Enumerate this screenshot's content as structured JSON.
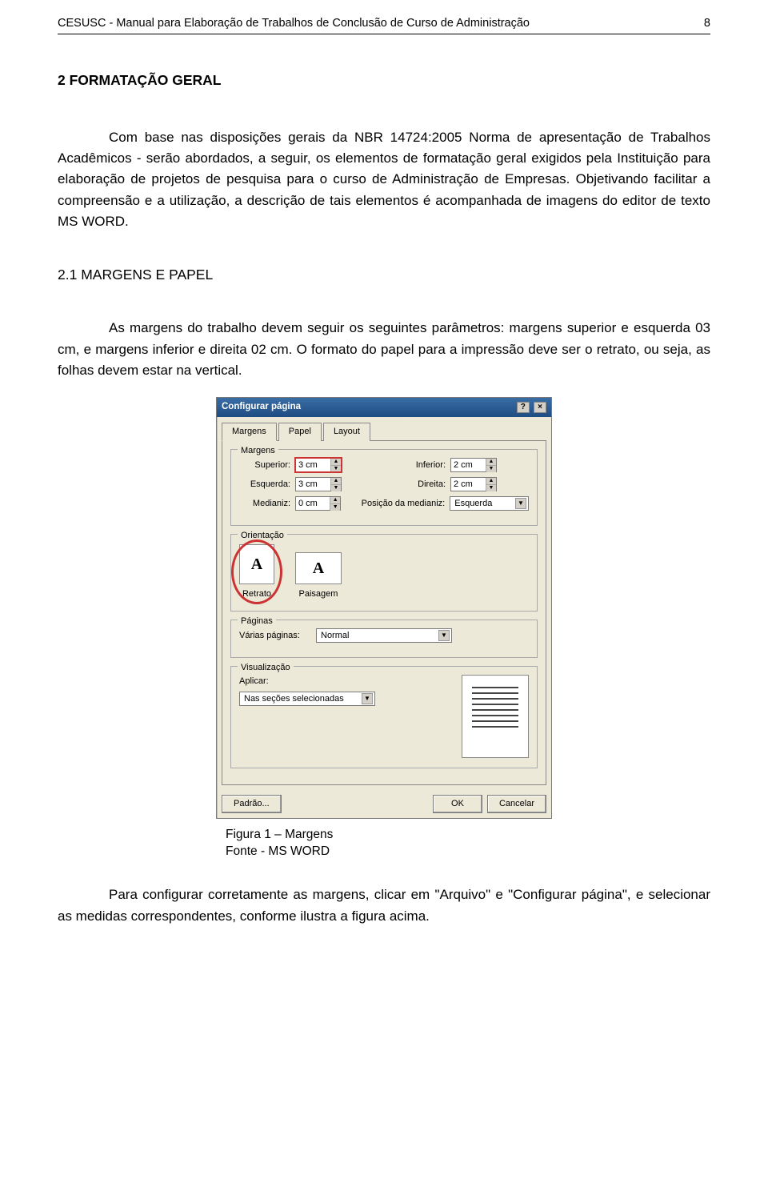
{
  "header": {
    "title": "CESUSC - Manual para Elaboração de Trabalhos de Conclusão de Curso de Administração",
    "page_number": "8"
  },
  "section": {
    "heading": "2 FORMATAÇÃO GERAL",
    "para1": "Com base nas disposições gerais da NBR 14724:2005 Norma de apresentação de Trabalhos Acadêmicos - serão abordados, a seguir, os elementos de formatação geral exigidos pela Instituição para elaboração de projetos de pesquisa para o curso de Administração de Empresas. Objetivando facilitar a compreensão e a utilização, a descrição de tais elementos é acompanhada de imagens do editor de texto MS WORD."
  },
  "subsection": {
    "heading": "2.1 MARGENS E PAPEL",
    "para1": "As margens do trabalho devem seguir os seguintes parâmetros: margens superior e esquerda 03 cm, e margens inferior e direita 02 cm. O formato do papel para a impressão deve ser o retrato, ou seja, as folhas devem estar na vertical."
  },
  "dialog": {
    "title": "Configurar página",
    "tabs": {
      "margens": "Margens",
      "papel": "Papel",
      "layout": "Layout"
    },
    "group_margens": "Margens",
    "labels": {
      "superior": "Superior:",
      "inferior": "Inferior:",
      "esquerda": "Esquerda:",
      "direita": "Direita:",
      "medianiz": "Medianiz:",
      "pos_medianiz": "Posição da medianiz:"
    },
    "values": {
      "superior": "3 cm",
      "inferior": "2 cm",
      "esquerda": "3 cm",
      "direita": "2 cm",
      "medianiz": "0 cm",
      "pos_medianiz": "Esquerda"
    },
    "group_orient": "Orientação",
    "orient": {
      "retrato": "Retrato",
      "paisagem": "Paisagem"
    },
    "group_pages": "Páginas",
    "pages_label": "Várias páginas:",
    "pages_value": "Normal",
    "group_preview": "Visualização",
    "apply_label": "Aplicar:",
    "apply_value": "Nas seções selecionadas",
    "buttons": {
      "padrao": "Padrão...",
      "ok": "OK",
      "cancel": "Cancelar"
    }
  },
  "caption": {
    "line1": "Figura 1 – Margens",
    "line2": "Fonte - MS WORD"
  },
  "footer_para": "Para configurar corretamente as margens, clicar em \"Arquivo\" e \"Configurar página\", e selecionar as medidas correspondentes, conforme ilustra a figura acima."
}
